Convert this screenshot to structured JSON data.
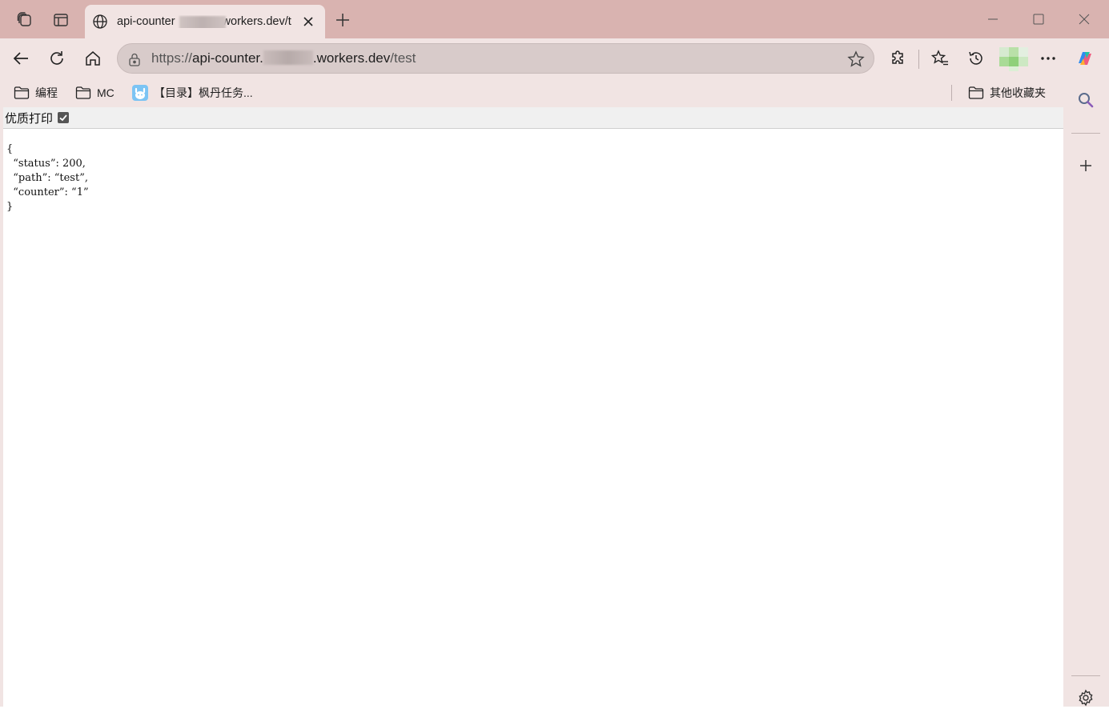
{
  "tab": {
    "title_prefix": "api-counter",
    "title_suffix": "workers.dev/t"
  },
  "address_bar": {
    "scheme": "https://",
    "host_prefix": "api-counter.",
    "host_suffix": ".workers.dev",
    "path": "/test"
  },
  "bookmarks": [
    {
      "label": "编程",
      "icon": "folder-icon"
    },
    {
      "label": "MC",
      "icon": "folder-icon"
    },
    {
      "label": "【目录】枫丹任务...",
      "icon": "site-favicon"
    },
    {
      "label": "其他收藏夹",
      "icon": "folder-icon"
    }
  ],
  "print_toggle": {
    "label": "优质打印",
    "checked": true
  },
  "json_body": "{\n  “status”: 200,\n  “path”: “test”,\n  “counter”: “1”\n}",
  "colors": {
    "frame": "#d9b3b0",
    "toolbar": "#f1e4e3",
    "omnibox": "#d8cbca"
  }
}
